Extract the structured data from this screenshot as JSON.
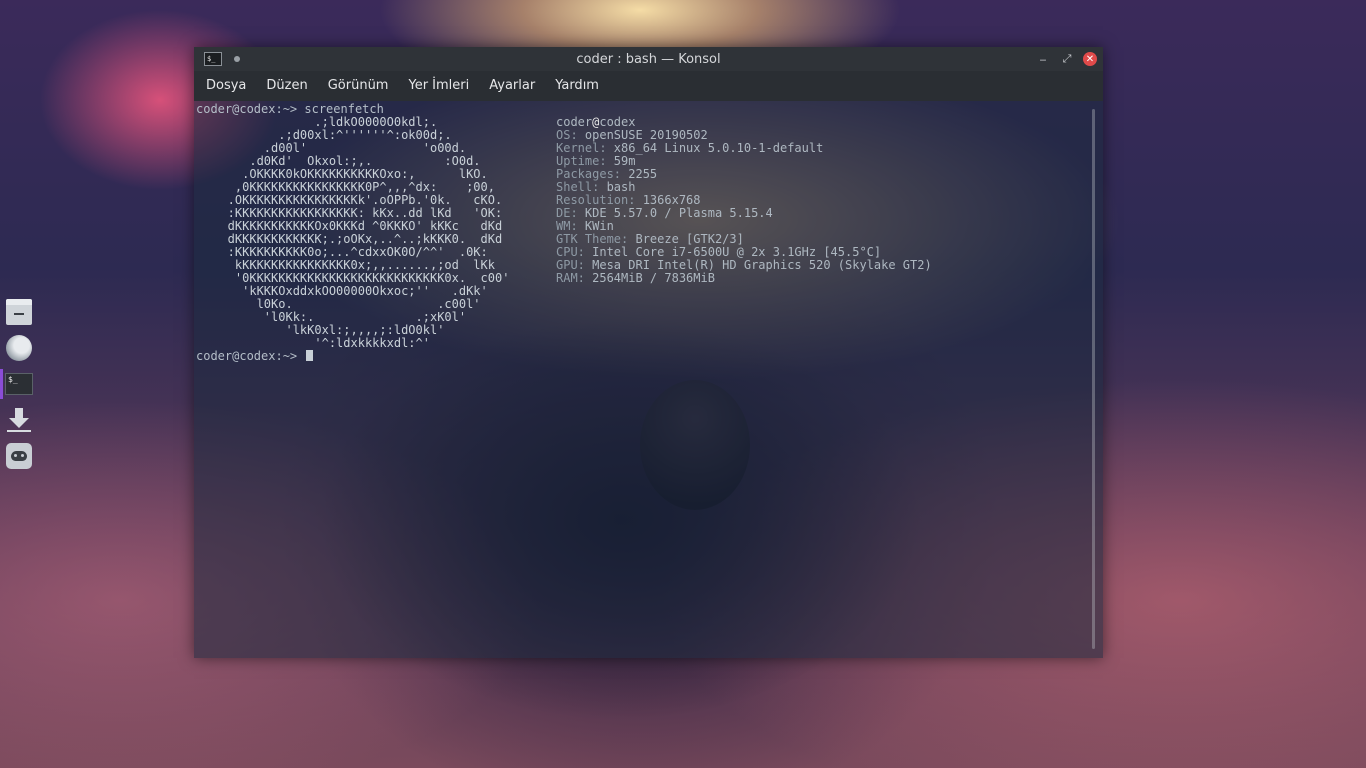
{
  "window": {
    "title": "coder : bash — Konsol",
    "icon_label": "$_",
    "controls": {
      "minimize": "‒",
      "maximize": "⤢",
      "close": "✕"
    }
  },
  "menubar": {
    "items": [
      "Dosya",
      "Düzen",
      "Görünüm",
      "Yer İmleri",
      "Ayarlar",
      "Yardım"
    ]
  },
  "terminal": {
    "command_line": "coder@codex:~> screenfetch",
    "prompt_line": "coder@codex:~> ",
    "logo": "               .;ldkO0000O0kdl;.\n          .;d00xl:^''''''^:ok00d;.\n        .d00l'                'o00d.\n      .d0Kd'  Okxol:;,.          :O0d.\n     .OKKKK0kOKKKKKKKKKKOxo:,      lKO.\n    ,0KKKKKKKKKKKKKKKK0P^,,,^dx:    ;00,\n   .OKKKKKKKKKKKKKKKKk'.oOPPb.'0k.   cKO.\n   :KKKKKKKKKKKKKKKKK: kKx..dd lKd   'OK:\n   dKKKKKKKKKKKOx0KKKd ^0KKKO' kKKc   dKd\n   dKKKKKKKKKKKK;.;oOKx,..^..;kKKK0.  dKd\n   :KKKKKKKKKK0o;...^cdxxOK0O/^^'  .0K:\n    kKKKKKKKKKKKKKKK0x;,,......,;od  lKk\n    '0KKKKKKKKKKKKKKKKKKKKKKKKKKK0x.  c00'\n     'kKKKOxddxkOO00000Okxoc;''   .dKk'\n       l0Ko.                    .c00l'\n        'l0Kk:.              .;xK0l'\n           'lkK0xl:;,,,,;:ldO0kl'\n               '^:ldxkkkkxdl:^'",
    "info": {
      "user": "coder",
      "at": "@",
      "host": "codex",
      "rows": [
        {
          "key": "OS:",
          "value": " openSUSE 20190502"
        },
        {
          "key": "Kernel:",
          "value": " x86_64 Linux 5.0.10-1-default"
        },
        {
          "key": "Uptime:",
          "value": " 59m"
        },
        {
          "key": "Packages:",
          "value": " 2255"
        },
        {
          "key": "Shell:",
          "value": " bash"
        },
        {
          "key": "Resolution:",
          "value": " 1366x768"
        },
        {
          "key": "DE:",
          "value": " KDE 5.57.0 / Plasma 5.15.4"
        },
        {
          "key": "WM:",
          "value": " KWin"
        },
        {
          "key": "GTK Theme:",
          "value": " Breeze [GTK2/3]"
        },
        {
          "key": "CPU:",
          "value": " Intel Core i7-6500U @ 2x 3.1GHz [45.5°C]"
        },
        {
          "key": "GPU:",
          "value": " Mesa DRI Intel(R) HD Graphics 520 (Skylake GT2)"
        },
        {
          "key": "RAM:",
          "value": " 2564MiB / 7836MiB"
        }
      ]
    }
  },
  "dock": {
    "terminal_icon_label": "$_"
  }
}
